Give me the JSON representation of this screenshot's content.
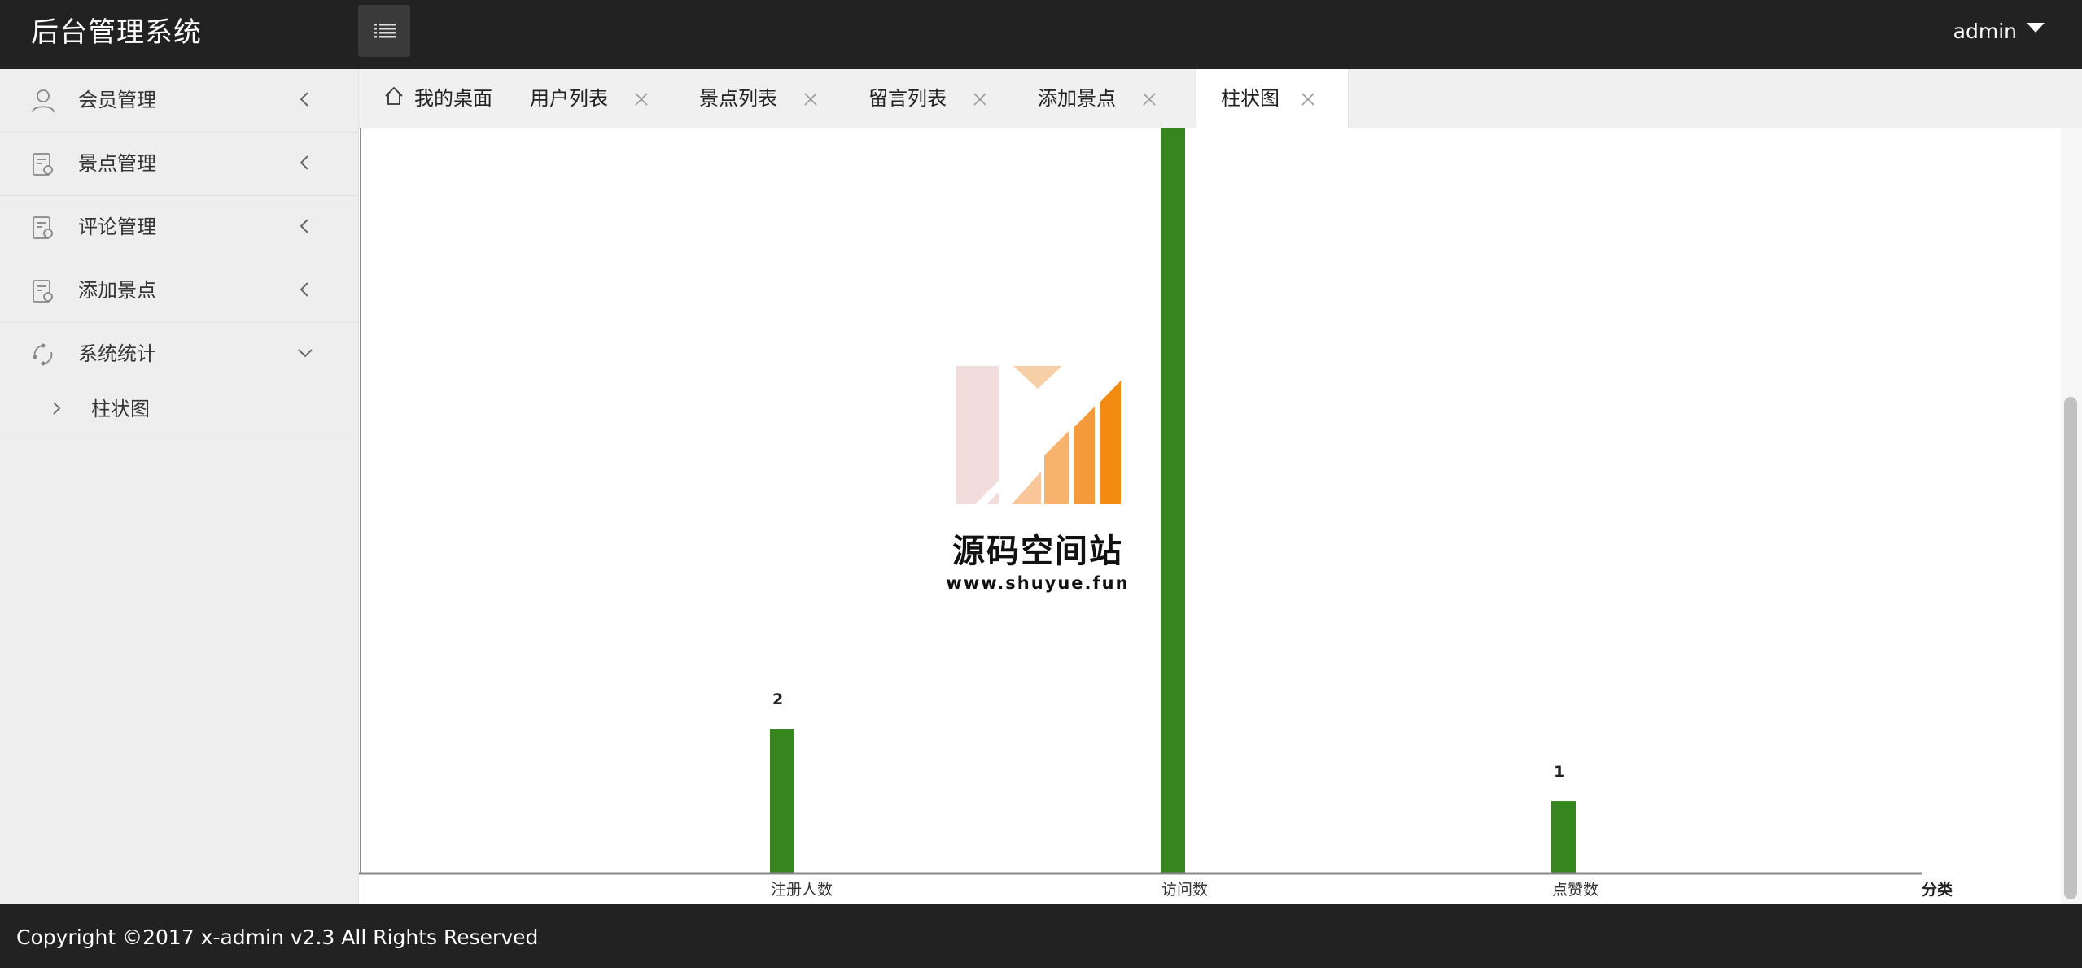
{
  "app": {
    "title": "后台管理系统",
    "user": "admin"
  },
  "sidebar": {
    "items": [
      {
        "label": "会员管理",
        "icon": "user-icon",
        "expanded": false
      },
      {
        "label": "景点管理",
        "icon": "document-icon",
        "expanded": false
      },
      {
        "label": "评论管理",
        "icon": "document-icon",
        "expanded": false
      },
      {
        "label": "添加景点",
        "icon": "document-icon",
        "expanded": false
      },
      {
        "label": "系统统计",
        "icon": "refresh-icon",
        "expanded": true
      }
    ],
    "sub_items": [
      {
        "label": "柱状图",
        "icon": "chevron-right-icon"
      }
    ]
  },
  "tabs": [
    {
      "label": "我的桌面",
      "closable": false,
      "icon": "home-icon"
    },
    {
      "label": "用户列表",
      "closable": true
    },
    {
      "label": "景点列表",
      "closable": true
    },
    {
      "label": "留言列表",
      "closable": true
    },
    {
      "label": "添加景点",
      "closable": true
    },
    {
      "label": "柱状图",
      "closable": true,
      "active": true
    }
  ],
  "chart_data": {
    "type": "bar",
    "categories": [
      "注册人数",
      "访问数",
      "点赞数"
    ],
    "values": [
      2,
      11,
      1
    ],
    "data_labels": [
      "2",
      "",
      "1"
    ],
    "xlabel": "分类",
    "ylabel": "",
    "ylim": [
      0,
      10.3
    ],
    "bar_color": "#36861e",
    "note": "访问数 bar extends beyond the visible top of the plot area"
  },
  "watermark": {
    "title": "源码空间站",
    "url": "www.shuyue.fun"
  },
  "footer": {
    "text": "Copyright ©2017 x-admin v2.3 All Rights Reserved"
  }
}
